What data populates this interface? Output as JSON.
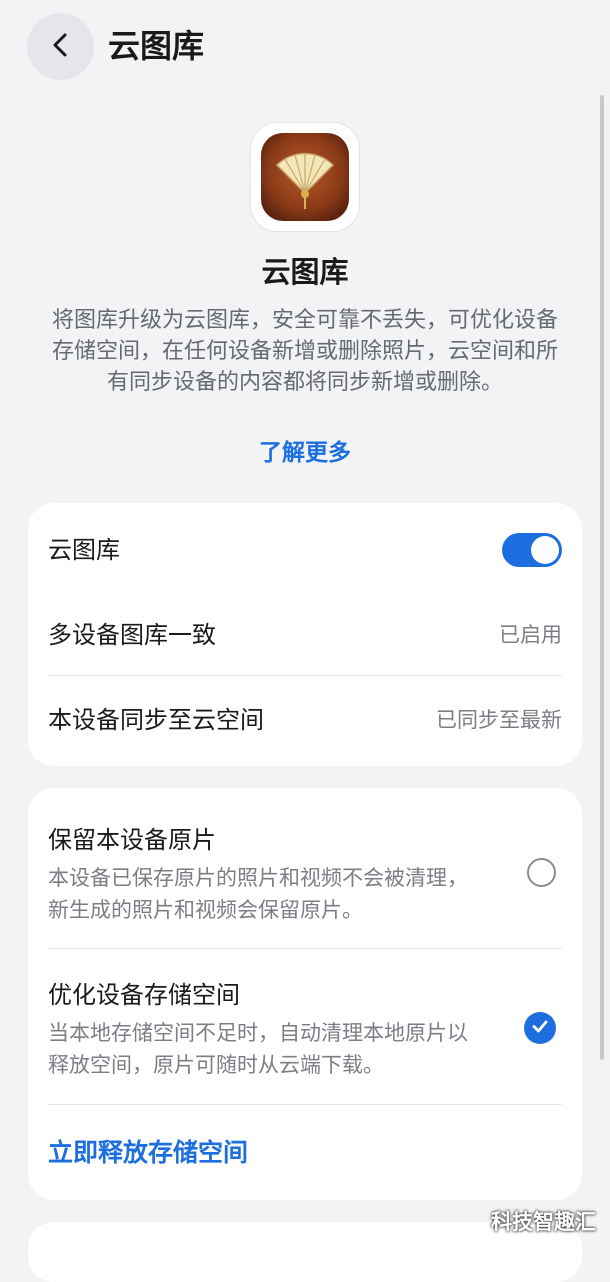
{
  "header": {
    "title": "云图库",
    "back_icon": "chevron-left-icon"
  },
  "intro": {
    "app_icon": "fan-app-icon",
    "app_name": "云图库",
    "description": "将图库升级为云图库，安全可靠不丢失，可优化设备存储空间，在任何设备新增或删除照片，云空间和所有同步设备的内容都将同步新增或删除。",
    "learn_more": "了解更多"
  },
  "sync_card": {
    "cloud_gallery_label": "云图库",
    "cloud_gallery_enabled": true,
    "multi_device_label": "多设备图库一致",
    "multi_device_status": "已启用",
    "device_sync_label": "本设备同步至云空间",
    "device_sync_status": "已同步至最新"
  },
  "storage_card": {
    "keep_originals": {
      "title": "保留本设备原片",
      "subtitle": "本设备已保存原片的照片和视频不会被清理，新生成的照片和视频会保留原片。",
      "selected": false
    },
    "optimize_storage": {
      "title": "优化设备存储空间",
      "subtitle": "当本地存储空间不足时，自动清理本地原片以释放空间，原片可随时从云端下载。",
      "selected": true
    },
    "free_space_action": "立即释放存储空间"
  },
  "watermark": "科技智趣汇",
  "colors": {
    "accent": "#1d6fe0",
    "background": "#f1f3f5",
    "card": "#ffffff"
  }
}
